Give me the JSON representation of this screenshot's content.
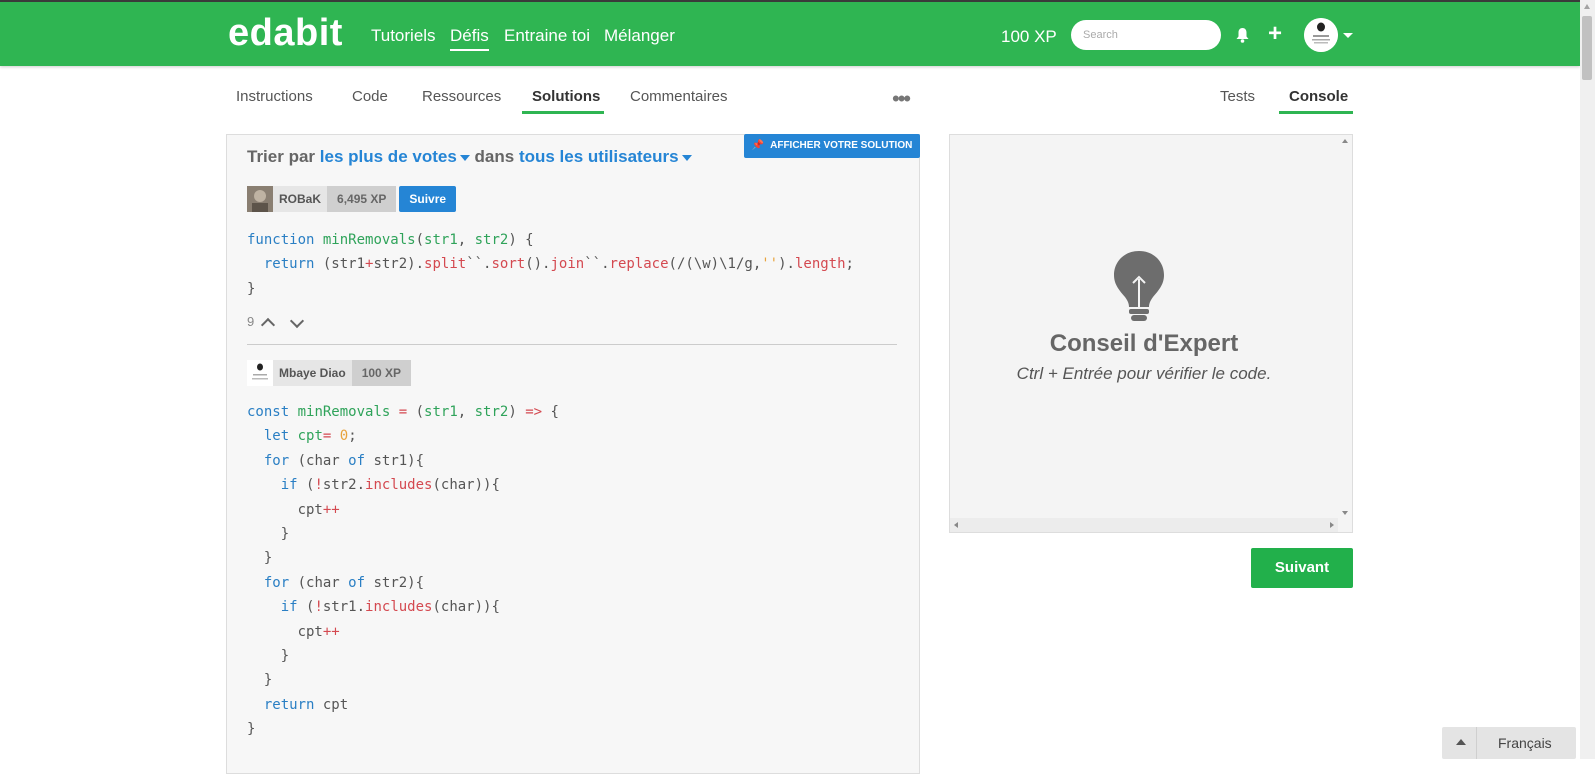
{
  "header": {
    "logo": "edabit",
    "nav": [
      "Tutoriels",
      "Défis",
      "Entraine toi",
      "Mélanger"
    ],
    "active_nav": "Défis",
    "xp": "100 XP",
    "search_placeholder": "Search"
  },
  "tabs": {
    "left": [
      "Instructions",
      "Code",
      "Ressources",
      "Solutions",
      "Commentaires"
    ],
    "active_left": "Solutions",
    "right": [
      "Tests",
      "Console"
    ],
    "active_right": "Console"
  },
  "solutions": {
    "pin_button": "AFFICHER VOTRE SOLUTION",
    "sort_prefix": "Trier par",
    "sort_value": "les plus de votes",
    "sort_middle": "dans",
    "sort_scope": "tous les utilisateurs",
    "items": [
      {
        "user": "ROBaK",
        "xp": "6,495 XP",
        "follow": "Suivre",
        "votes": "9"
      },
      {
        "user": "Mbaye Diao",
        "xp": "100 XP"
      }
    ]
  },
  "console": {
    "tip_title": "Conseil d'Expert",
    "tip_text": "Ctrl + Entrée pour vérifier le code."
  },
  "next_button": "Suivant",
  "language": "Français",
  "colors": {
    "brand_green": "#2fb552",
    "link_blue": "#2585d5",
    "keyword": "#2a7fc4",
    "function": "#2fa35a",
    "property": "#d44950"
  }
}
